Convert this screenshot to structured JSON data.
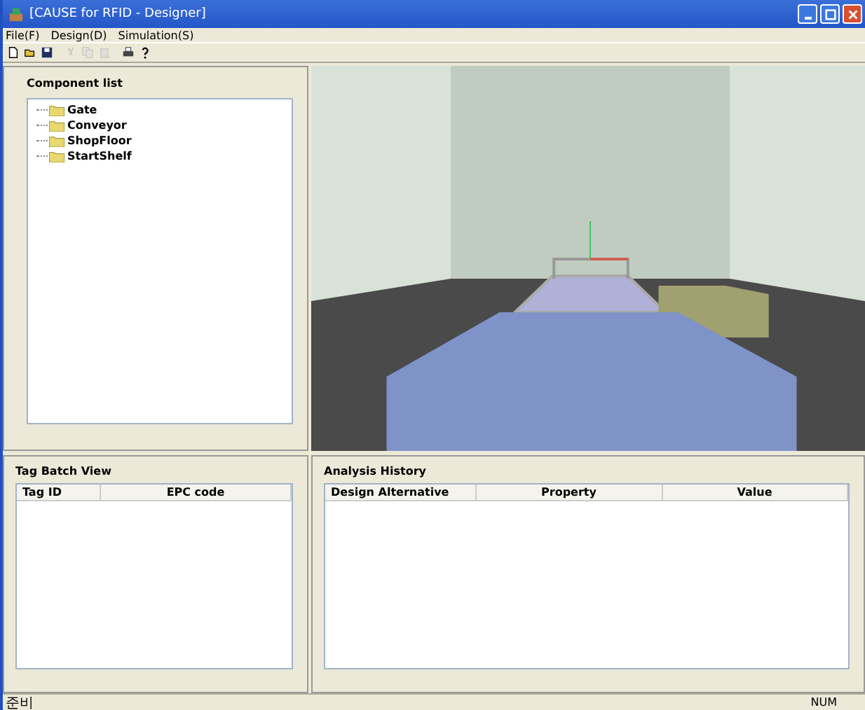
{
  "window": {
    "title": "[CAUSE for RFID - Designer]"
  },
  "menu": [
    "File(F)",
    "Design(D)",
    "Simulation(S)"
  ],
  "toolbar": [
    {
      "kind": "new",
      "disabled": false
    },
    {
      "kind": "open",
      "disabled": false
    },
    {
      "kind": "save",
      "disabled": false
    },
    {
      "kind": "cut",
      "disabled": true
    },
    {
      "kind": "copy",
      "disabled": true
    },
    {
      "kind": "paste",
      "disabled": true
    },
    {
      "kind": "print",
      "disabled": false
    },
    {
      "kind": "help",
      "disabled": false
    }
  ],
  "component_list": {
    "title": "Component list",
    "items": [
      {
        "label": "Gate"
      },
      {
        "label": "Conveyor"
      },
      {
        "label": "ShopFloor"
      },
      {
        "label": "StartShelf"
      }
    ]
  },
  "tag_batch_view": {
    "title": "Tag Batch View",
    "columns": [
      "Tag ID",
      "EPC code"
    ]
  },
  "analysis_history": {
    "title": "Analysis History",
    "columns": [
      "Design Alternative",
      "Property",
      "Value"
    ]
  },
  "status_bar": {
    "message": "준비",
    "indicator": "NUM"
  }
}
